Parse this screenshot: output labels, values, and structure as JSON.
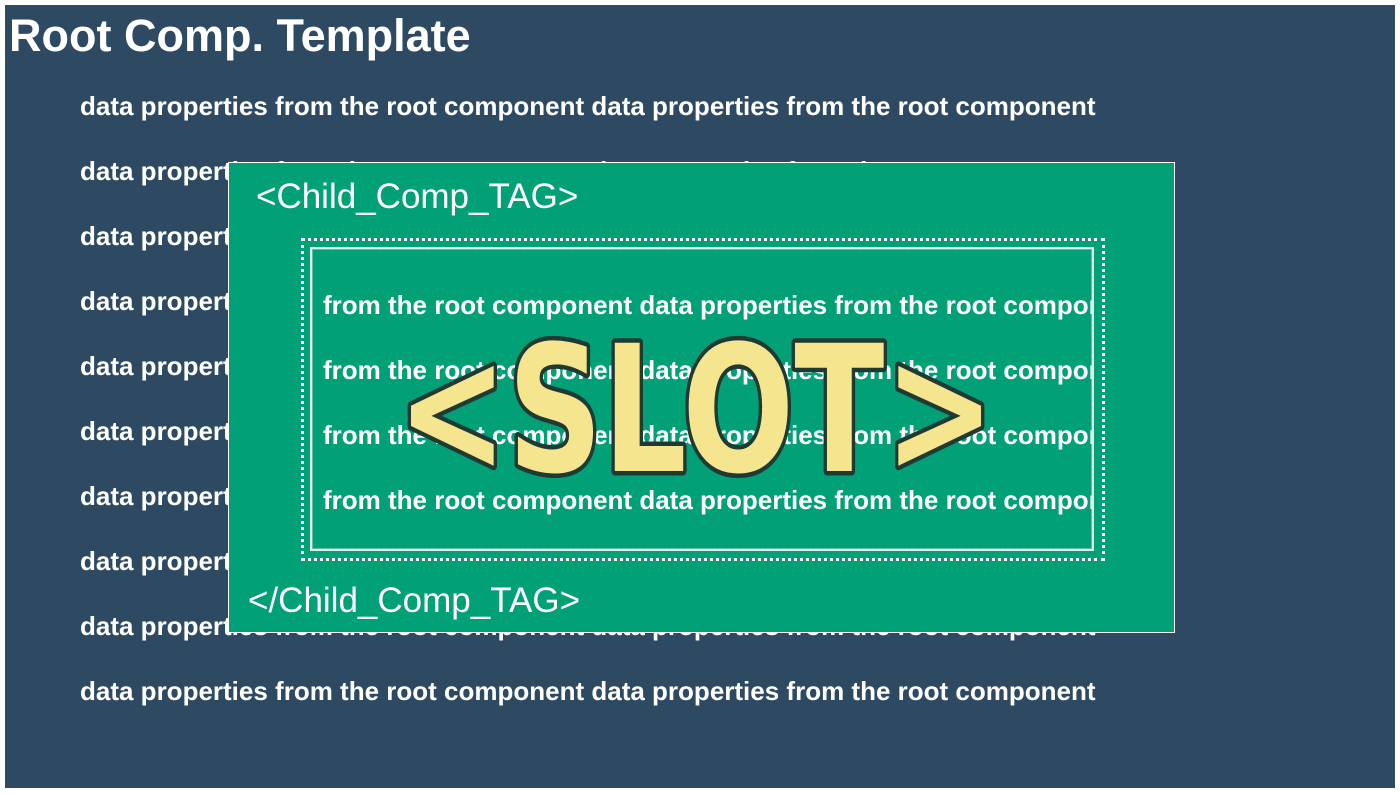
{
  "root": {
    "title": "Root Comp. Template",
    "data_line": "data properties from the root component data properties from the root component"
  },
  "child": {
    "open_tag": "<Child_Comp_TAG>",
    "close_tag": "</Child_Comp_TAG>"
  },
  "slot": {
    "label": "<SLOT>",
    "data_line": "from the root component data properties from the root component",
    "label_color": "#f5e58f",
    "outline_color": "#1e3a33"
  },
  "colors": {
    "root_background": "#2e4a63",
    "child_background": "#02a077",
    "text": "#ffffff"
  }
}
